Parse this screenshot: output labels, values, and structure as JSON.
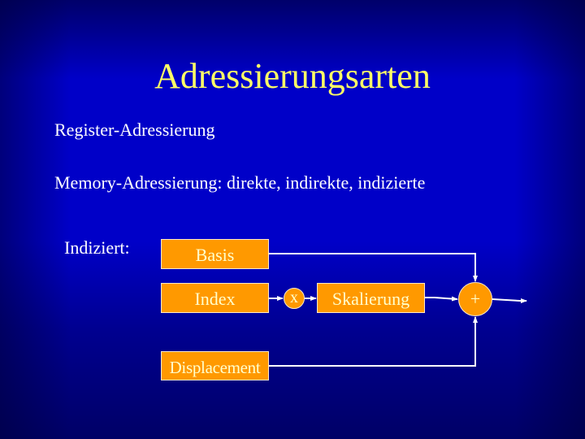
{
  "slide": {
    "title": "Adressierungsarten",
    "bullets": [
      "Register-Adressierung",
      "Memory-Adressierung: direkte, indirekte, indizierte"
    ],
    "diagram_label": "Indiziert:",
    "diagram": {
      "boxes": {
        "basis": "Basis",
        "index": "Index",
        "skalierung": "Skalierung",
        "displacement": "Displacement"
      },
      "operators": {
        "multiply": "x",
        "add": "+"
      },
      "connections": [
        {
          "from": "Basis",
          "to": "+"
        },
        {
          "from": "Index",
          "to": "x"
        },
        {
          "from": "x",
          "to": "Skalierung"
        },
        {
          "from": "Skalierung",
          "to": "+"
        },
        {
          "from": "Displacement",
          "to": "+"
        },
        {
          "from": "+",
          "to": "output"
        }
      ]
    },
    "colors": {
      "title": "#ffff66",
      "text": "#ffffff",
      "box_fill": "#ff9900",
      "box_text": "#ffffcc",
      "background_center": "#0000c8",
      "background_edge": "#000066"
    }
  }
}
